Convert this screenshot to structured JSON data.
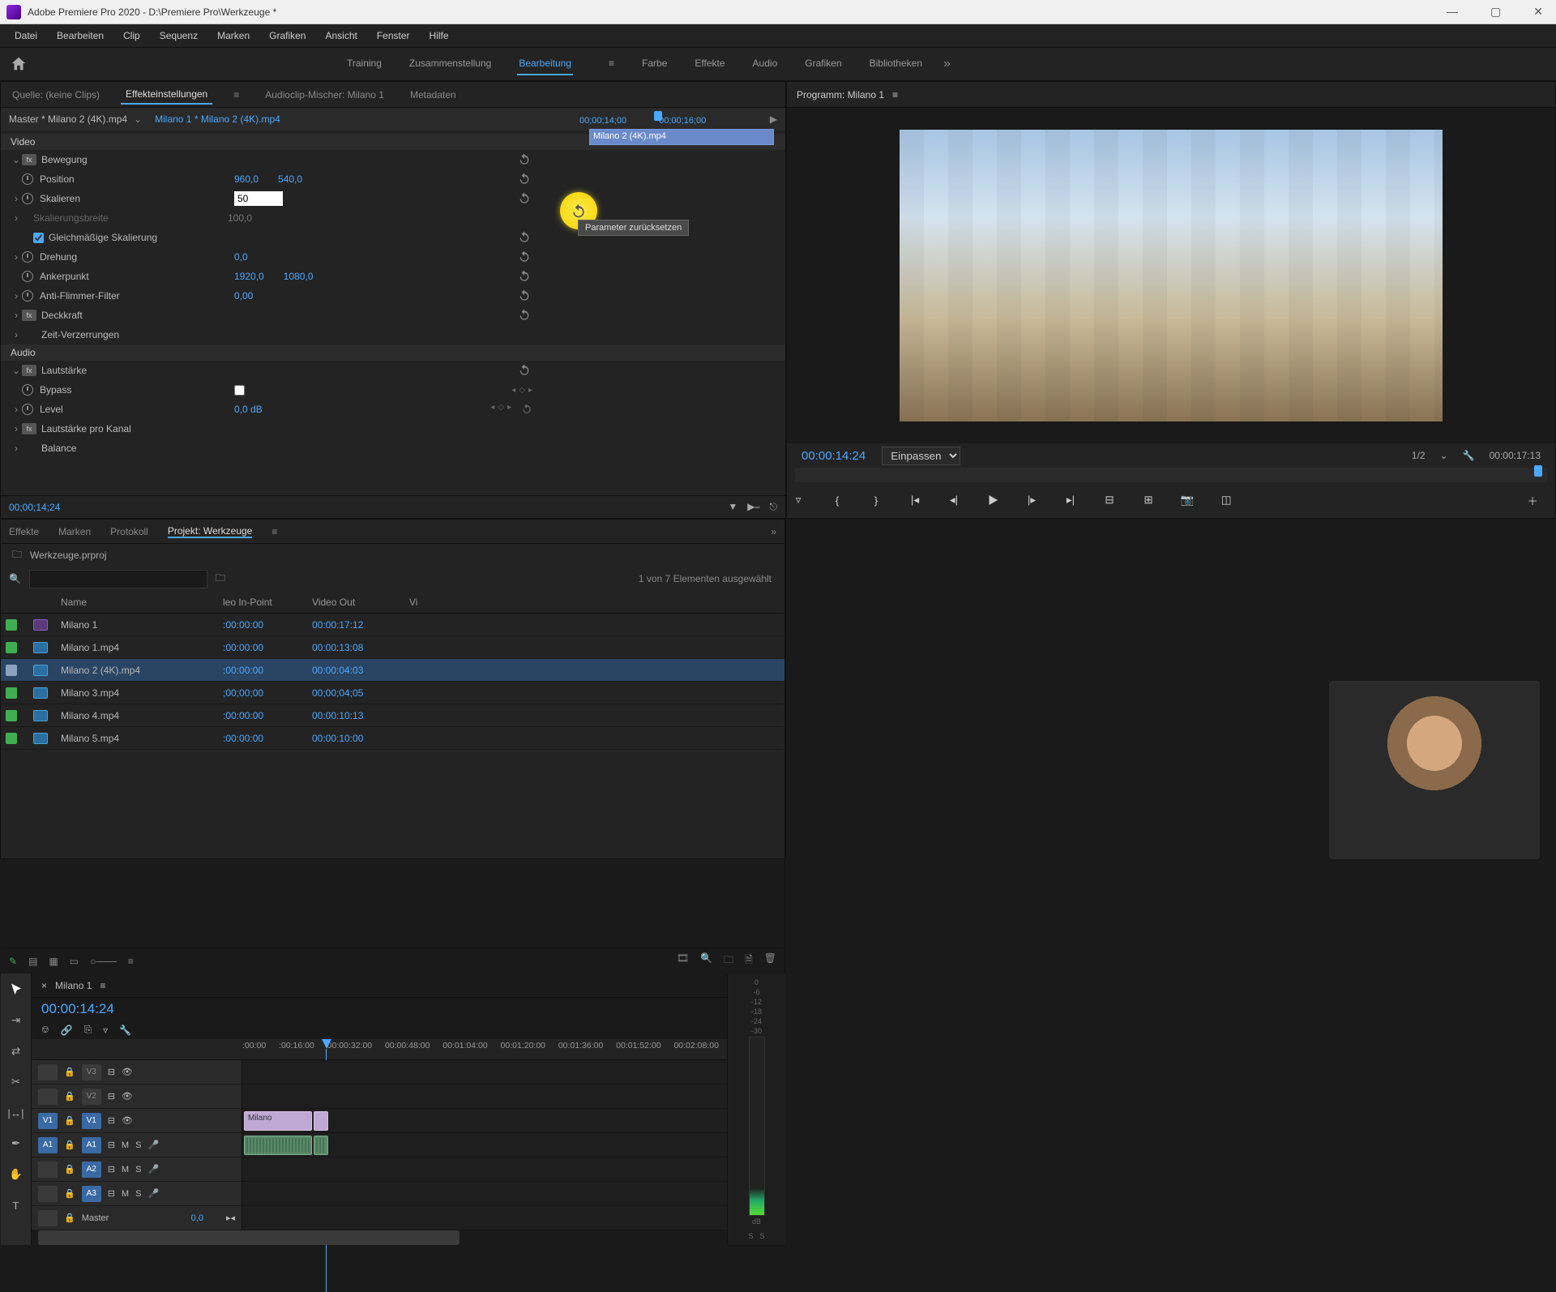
{
  "app": {
    "title": "Adobe Premiere Pro 2020 - D:\\Premiere Pro\\Werkzeuge *"
  },
  "menu": [
    "Datei",
    "Bearbeiten",
    "Clip",
    "Sequenz",
    "Marken",
    "Grafiken",
    "Ansicht",
    "Fenster",
    "Hilfe"
  ],
  "workspaces": {
    "items": [
      "Training",
      "Zusammenstellung",
      "Bearbeitung",
      "Farbe",
      "Effekte",
      "Audio",
      "Grafiken",
      "Bibliotheken"
    ],
    "active": "Bearbeitung"
  },
  "source_tabs": {
    "items": [
      "Quelle: (keine Clips)",
      "Effekteinstellungen",
      "Audioclip-Mischer: Milano 1",
      "Metadaten"
    ],
    "active": "Effekteinstellungen"
  },
  "effect_controls": {
    "master": "Master * Milano 2 (4K).mp4",
    "sequence": "Milano 1 * Milano 2 (4K).mp4",
    "mini_timeline": {
      "t1": "00;00;14;00",
      "t2": "00;00;16;00"
    },
    "clip_name": "Milano 2 (4K).mp4",
    "section_video": "Video",
    "motion": {
      "label": "Bewegung",
      "position": {
        "label": "Position",
        "x": "960,0",
        "y": "540,0"
      },
      "scale": {
        "label": "Skalieren",
        "value": "50"
      },
      "scale_width": {
        "label": "Skalierungsbreite",
        "value": "100,0"
      },
      "uniform": {
        "label": "Gleichmäßige Skalierung",
        "checked": true
      },
      "rotation": {
        "label": "Drehung",
        "value": "0,0"
      },
      "anchor": {
        "label": "Ankerpunkt",
        "x": "1920,0",
        "y": "1080,0"
      },
      "antiflicker": {
        "label": "Anti-Flimmer-Filter",
        "value": "0,00"
      }
    },
    "opacity": {
      "label": "Deckkraft"
    },
    "time_remap": {
      "label": "Zeit-Verzerrungen"
    },
    "section_audio": "Audio",
    "volume": {
      "label": "Lautstärke",
      "bypass": {
        "label": "Bypass",
        "checked": false
      },
      "level": {
        "label": "Level",
        "value": "0,0 dB"
      }
    },
    "channel_volume": {
      "label": "Lautstärke pro Kanal"
    },
    "balance": {
      "label": "Balance"
    },
    "tooltip": "Parameter zurücksetzen",
    "timecode": "00;00;14;24"
  },
  "program": {
    "title": "Programm: Milano 1",
    "timecode": "00:00:14:24",
    "fit": "Einpassen",
    "scale": "1/2",
    "duration": "00:00:17:13"
  },
  "project_tabs": {
    "items": [
      "Effekte",
      "Marken",
      "Protokoll",
      "Projekt: Werkzeuge"
    ],
    "active": "Projekt: Werkzeuge"
  },
  "project": {
    "name": "Werkzeuge.prproj",
    "selection": "1 von 7 Elementen ausgewählt",
    "columns": {
      "name": "Name",
      "in": "leo In-Point",
      "out": "Video Out",
      "vi": "Vi"
    },
    "rows": [
      {
        "name": "Milano 1",
        "in": ":00:00:00",
        "out": "00:00:17:12",
        "seq": true,
        "sel": false
      },
      {
        "name": "Milano 1.mp4",
        "in": ":00:00:00",
        "out": "00:00:13:08",
        "seq": false,
        "sel": false
      },
      {
        "name": "Milano 2 (4K).mp4",
        "in": ":00:00:00",
        "out": "00:00:04:03",
        "seq": false,
        "sel": true
      },
      {
        "name": "Milano 3.mp4",
        "in": ";00;00;00",
        "out": "00;00;04;05",
        "seq": false,
        "sel": false
      },
      {
        "name": "Milano 4.mp4",
        "in": ":00:00:00",
        "out": "00:00:10:13",
        "seq": false,
        "sel": false
      },
      {
        "name": "Milano 5.mp4",
        "in": ":00:00:00",
        "out": "00:00:10:00",
        "seq": false,
        "sel": false
      }
    ]
  },
  "timeline": {
    "sequence": "Milano 1",
    "timecode": "00:00:14:24",
    "ruler": [
      ":00:00",
      ":00:16:00",
      "00:00:32:00",
      "00:00:48:00",
      "00:01:04:00",
      "00:01:20:00",
      "00:01:36:00",
      "00:01:52:00",
      "00:02:08:00"
    ],
    "tracks_v": [
      "V3",
      "V2",
      "V1"
    ],
    "tracks_a": [
      "A1",
      "A2",
      "A3"
    ],
    "master_label": "Master",
    "master_val": "0,0",
    "clip_v1": "Milano"
  },
  "meters": {
    "s": "S"
  }
}
